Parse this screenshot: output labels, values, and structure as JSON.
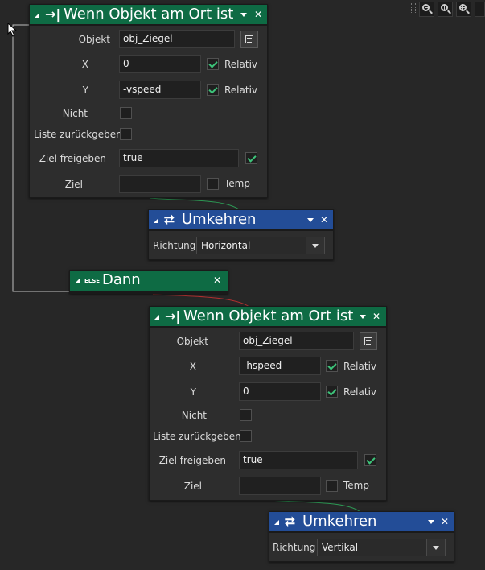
{
  "nodes": {
    "if1": {
      "title": "Wenn Objekt am Ort ist",
      "objekt_label": "Objekt",
      "objekt_value": "obj_Ziegel",
      "x_label": "X",
      "x_value": "0",
      "x_relativ": "Relativ",
      "y_label": "Y",
      "y_value": "-vspeed",
      "y_relativ": "Relativ",
      "nicht_label": "Nicht",
      "liste_label": "Liste zurückgeben",
      "ziel_frei_label": "Ziel freigeben",
      "ziel_frei_value": "true",
      "ziel_label": "Ziel",
      "ziel_value": "",
      "temp_label": "Temp"
    },
    "rev1": {
      "title": "Umkehren",
      "richtung_label": "Richtung",
      "richtung_value": "Horizontal"
    },
    "else": {
      "badge": "ELSE",
      "title": "Dann"
    },
    "if2": {
      "title": "Wenn Objekt am Ort ist",
      "objekt_label": "Objekt",
      "objekt_value": "obj_Ziegel",
      "x_label": "X",
      "x_value": "-hspeed",
      "x_relativ": "Relativ",
      "y_label": "Y",
      "y_value": "0",
      "y_relativ": "Relativ",
      "nicht_label": "Nicht",
      "liste_label": "Liste zurückgeben",
      "ziel_frei_label": "Ziel freigeben",
      "ziel_frei_value": "true",
      "ziel_label": "Ziel",
      "ziel_value": "",
      "temp_label": "Temp"
    },
    "rev2": {
      "title": "Umkehren",
      "richtung_label": "Richtung",
      "richtung_value": "Vertikal"
    }
  },
  "icons": {
    "if": "arrow-to-bar-icon",
    "reverse": "reverse-arrows-icon",
    "zoom_out": "zoom-out-icon",
    "zoom_reset": "zoom-reset-icon",
    "zoom_in": "zoom-in-icon",
    "cursor": "mouse-cursor-icon"
  },
  "colors": {
    "background": "#272727",
    "if_header": "#0e6b44",
    "action_header": "#234d97",
    "checkbox_check": "#3dc47a"
  },
  "checkboxes": {
    "if1": {
      "x_relativ": true,
      "y_relativ": true,
      "nicht": false,
      "liste": false,
      "ziel_frei": true,
      "temp": false
    },
    "if2": {
      "x_relativ": true,
      "y_relativ": true,
      "nicht": false,
      "liste": false,
      "ziel_frei": true,
      "temp": false
    }
  }
}
